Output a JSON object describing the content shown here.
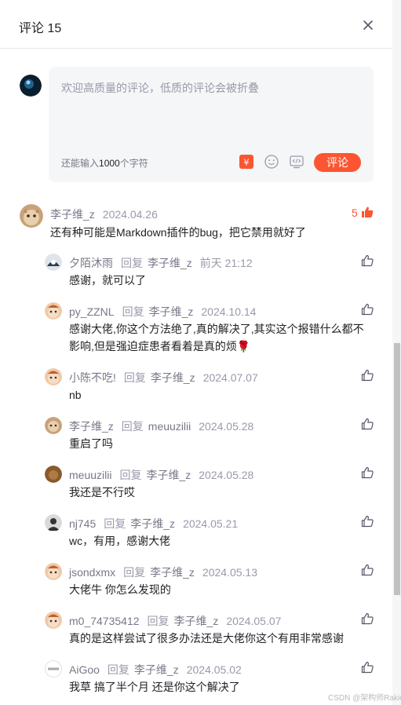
{
  "header": {
    "title": "评论 15"
  },
  "composer": {
    "placeholder": "欢迎高质量的评论，低质的评论会被折叠",
    "counter_prefix": "还能输入",
    "counter_number": "1000",
    "counter_suffix": "个字符",
    "submit_label": "评论"
  },
  "comment": {
    "author": "李子维_z",
    "date": "2024.04.26",
    "text": "还有种可能是Markdown插件的bug，把它禁用就好了",
    "likes": "5"
  },
  "reply_word": "回复",
  "replies": [
    {
      "author": "夕陌沐雨",
      "target": "李子维_z",
      "date": "前天 21:12",
      "text": "感谢，就可以了"
    },
    {
      "author": "py_ZZNL",
      "target": "李子维_z",
      "date": "2024.10.14",
      "text": "感谢大佬,你这个方法绝了,真的解决了,其实这个报错什么都不",
      "text2": "影响,但是强迫症患者看着是真的烦🌹"
    },
    {
      "author": "小陈不吃!",
      "target": "李子维_z",
      "date": "2024.07.07",
      "text": "nb"
    },
    {
      "author": "李子维_z",
      "target": "meuuzilii",
      "date": "2024.05.28",
      "text": "重启了吗"
    },
    {
      "author": "meuuzilii",
      "target": "李子维_z",
      "date": "2024.05.28",
      "text": "我还是不行哎"
    },
    {
      "author": "nj745",
      "target": "李子维_z",
      "date": "2024.05.21",
      "text": "wc，有用，感谢大佬"
    },
    {
      "author": "jsondxmx",
      "target": "李子维_z",
      "date": "2024.05.13",
      "text": "大佬牛 你怎么发现的"
    },
    {
      "author": "m0_74735412",
      "target": "李子维_z",
      "date": "2024.05.07",
      "text": "真的是这样尝试了很多办法还是大佬你这个有用非常感谢"
    },
    {
      "author": "AiGoo⁣",
      "target": "李子维_z",
      "date": "2024.05.02",
      "text": "我草 搞了半个月 还是你这个解决了"
    }
  ],
  "watermark": "CSDN @架构师Rakic",
  "colors": {
    "accent": "#fc5531",
    "meta": "#999aaa",
    "text": "#222226",
    "composer_bg": "#f5f6f7"
  }
}
